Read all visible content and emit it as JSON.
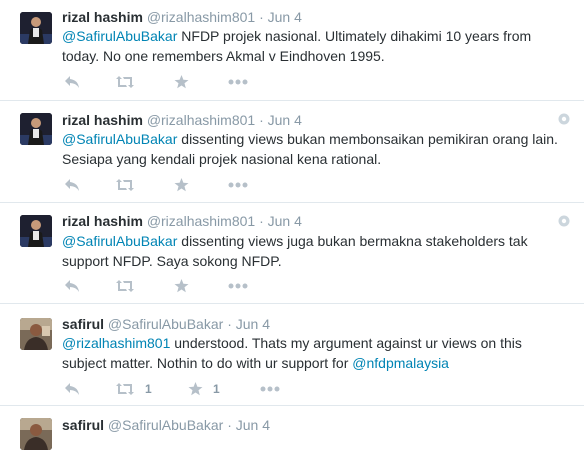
{
  "tweets": [
    {
      "fullname": "rizal hashim",
      "handle": "@rizalhashim801",
      "sep": "·",
      "time": "Jun 4",
      "mention": "@SafirulAbuBakar",
      "line1_rest": " NFDP projek nasional. Ultimately dihakimi 10 years from",
      "line2": "today. No one remembers Akmal v Eindhoven 1995.",
      "retweet_count": "",
      "favorite_count": ""
    },
    {
      "fullname": "rizal hashim",
      "handle": "@rizalhashim801",
      "sep": "·",
      "time": "Jun 4",
      "mention": "@SafirulAbuBakar",
      "line1_rest": " dissenting views bukan membonsaikan pemikiran orang lain.",
      "line2": "Sesiapa yang kendali projek nasional kena rational.",
      "retweet_count": "",
      "favorite_count": ""
    },
    {
      "fullname": "rizal hashim",
      "handle": "@rizalhashim801",
      "sep": "·",
      "time": "Jun 4",
      "mention": "@SafirulAbuBakar",
      "line1_rest": " dissenting views juga bukan bermakna stakeholders tak",
      "line2": "support NFDP. Saya sokong NFDP.",
      "retweet_count": "",
      "favorite_count": ""
    },
    {
      "fullname": "safirul",
      "handle": "@SafirulAbuBakar",
      "sep": "·",
      "time": "Jun 4",
      "mention": "@rizalhashim801",
      "line1_rest": "  understood. Thats my argument against ur views on this",
      "line2": "subject matter. Nothin to do with ur support for ",
      "line2_mention": "@nfdpmalaysia",
      "retweet_count": "1",
      "favorite_count": "1"
    },
    {
      "fullname": "safirul",
      "handle": "@SafirulAbuBakar",
      "sep": "·",
      "time": "Jun 4"
    }
  ],
  "colors": {
    "link": "#0084b4",
    "meta": "#8899a6",
    "icon": "#b6c0c9",
    "divider": "#e1e8ed"
  },
  "icons": [
    "reply-icon",
    "retweet-icon",
    "favorite-icon",
    "more-icon",
    "gear-icon"
  ]
}
